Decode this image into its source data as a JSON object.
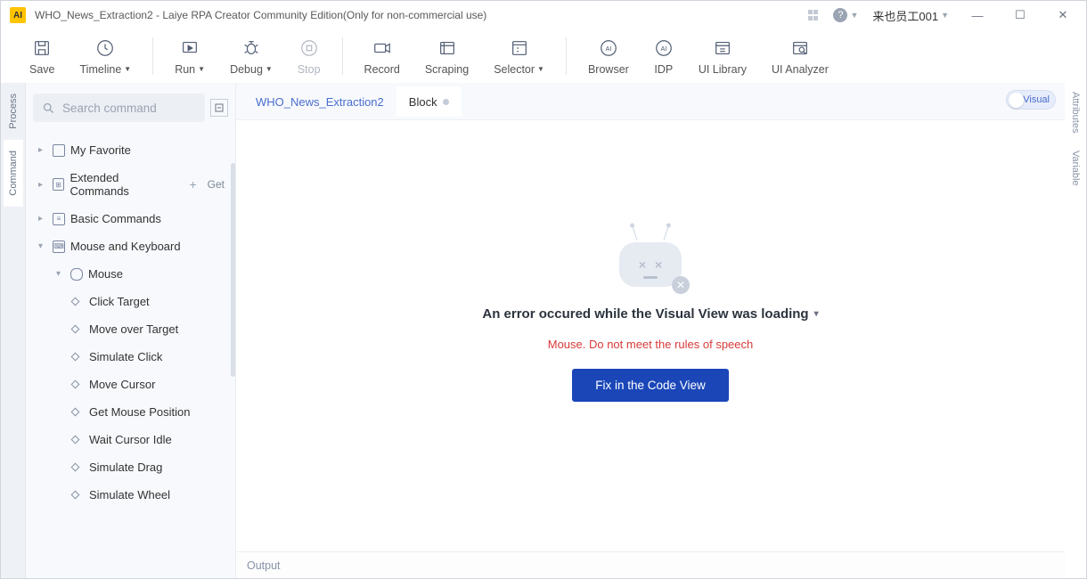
{
  "title_bar": {
    "title": "WHO_News_Extraction2 - Laiye RPA Creator Community Edition(Only for non-commercial use)",
    "user": "来也员工001"
  },
  "toolbar": {
    "save": "Save",
    "timeline": "Timeline",
    "run": "Run",
    "debug": "Debug",
    "stop": "Stop",
    "record": "Record",
    "scraping": "Scraping",
    "selector": "Selector",
    "browser": "Browser",
    "idp": "IDP",
    "uilib": "UI Library",
    "uianalyzer": "UI Analyzer"
  },
  "left_tabs": {
    "process": "Process",
    "command": "Command"
  },
  "right_tabs": {
    "attributes": "Attributes",
    "variable": "Variable"
  },
  "cmd_panel": {
    "search_placeholder": "Search command",
    "myfav": "My Favorite",
    "ext": "Extended Commands",
    "ext_get": "Get",
    "basic": "Basic Commands",
    "mk": "Mouse and Keyboard",
    "mouse": "Mouse",
    "mouse_items": [
      "Click Target",
      "Move over Target",
      "Simulate Click",
      "Move Cursor",
      "Get Mouse Position",
      "Wait Cursor Idle",
      "Simulate Drag",
      "Simulate Wheel"
    ]
  },
  "tabs": {
    "file": "WHO_News_Extraction2",
    "block": "Block"
  },
  "visual_toggle": "Visual",
  "error": {
    "heading": "An error occured while the Visual View was loading",
    "message": "Mouse. Do not meet the rules of speech",
    "button": "Fix in the Code View"
  },
  "output": "Output"
}
